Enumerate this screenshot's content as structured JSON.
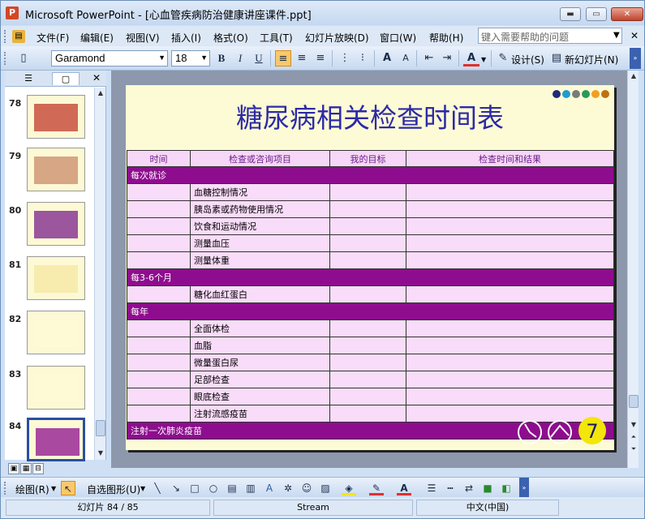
{
  "window": {
    "title": "Microsoft PowerPoint - [心血管疾病防治健康讲座课件.ppt]",
    "app_icon": "P"
  },
  "menu": [
    "文件(F)",
    "编辑(E)",
    "视图(V)",
    "插入(I)",
    "格式(O)",
    "工具(T)",
    "幻灯片放映(D)",
    "窗口(W)",
    "帮助(H)"
  ],
  "help_placeholder": "键入需要帮助的问题",
  "toolbar": {
    "font": "Garamond",
    "size": "18",
    "design_label": "设计(S)",
    "new_slide_label": "新幻灯片(N)"
  },
  "thumbnails": [
    {
      "num": "78"
    },
    {
      "num": "79"
    },
    {
      "num": "80"
    },
    {
      "num": "81"
    },
    {
      "num": "82"
    },
    {
      "num": "83"
    },
    {
      "num": "84"
    }
  ],
  "slide": {
    "title": "糖尿病相关检查时间表",
    "dot_colors": [
      "#1f2a7a",
      "#1f9ccd",
      "#7a7a7a",
      "#2a9a5a",
      "#f0a020",
      "#c07010"
    ],
    "headers": [
      "时间",
      "检查或咨询项目",
      "我的目标",
      "检查时间和结果"
    ],
    "groups": [
      {
        "label": "每次就诊",
        "items": [
          "血糖控制情况",
          "胰岛素或药物使用情况",
          "饮食和运动情况",
          "测量血压",
          "测量体重"
        ]
      },
      {
        "label": "每3-6个月",
        "items": [
          "糖化血红蛋白"
        ]
      },
      {
        "label": "每年",
        "items": [
          "全面体检",
          "血脂",
          "微量蛋白尿",
          "足部检查",
          "眼底检查",
          "注射流感疫苗"
        ]
      },
      {
        "label": "注射一次肺炎疫苗",
        "items": []
      }
    ]
  },
  "drawing_bar": {
    "draw_label": "绘图(R)",
    "autoshape_label": "自选图形(U)"
  },
  "status": {
    "slide_info": "幻灯片 84 / 85",
    "design": "Stream",
    "language": "中文(中国)"
  }
}
